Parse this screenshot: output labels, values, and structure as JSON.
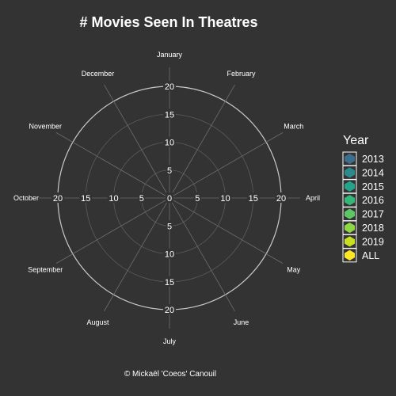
{
  "chart_data": {
    "type": "radar",
    "title": "# Movies Seen In Theatres",
    "categories": [
      "January",
      "February",
      "March",
      "April",
      "May",
      "June",
      "July",
      "August",
      "September",
      "October",
      "November",
      "December"
    ],
    "rlim": [
      0,
      20
    ],
    "r_ticks": [
      "0",
      "5",
      "10",
      "15",
      "20"
    ],
    "grid": true,
    "legend_position": "right",
    "legend_title": "Year",
    "series": [
      {
        "name": "2013",
        "color": "#3E6E8E",
        "values": [
          0,
          0,
          0,
          0,
          0,
          0,
          0,
          0,
          0,
          0,
          0,
          0
        ]
      },
      {
        "name": "2014",
        "color": "#2A8A8C",
        "values": [
          0,
          0,
          0,
          0,
          0,
          0,
          0,
          0,
          0,
          0,
          0,
          0
        ]
      },
      {
        "name": "2015",
        "color": "#22A38A",
        "values": [
          0,
          0,
          0,
          0,
          0,
          0,
          0,
          0,
          0,
          0,
          0,
          0
        ]
      },
      {
        "name": "2016",
        "color": "#35B779",
        "values": [
          0,
          0,
          0,
          0,
          0,
          0,
          0,
          0,
          0,
          0,
          0,
          0
        ]
      },
      {
        "name": "2017",
        "color": "#5CC863",
        "values": [
          0,
          0,
          0,
          0,
          0,
          0,
          0,
          0,
          0,
          0,
          0,
          0
        ]
      },
      {
        "name": "2018",
        "color": "#8FD744",
        "values": [
          0,
          0,
          0,
          0,
          0,
          0,
          0,
          0,
          0,
          0,
          0,
          0
        ]
      },
      {
        "name": "2019",
        "color": "#C7E020",
        "values": [
          0,
          0,
          0,
          0,
          0,
          0,
          0,
          0,
          0,
          0,
          0,
          0
        ]
      },
      {
        "name": "ALL",
        "color": "#FDE725",
        "values": [
          0,
          0,
          0,
          0,
          0,
          0,
          0,
          0,
          0,
          0,
          0,
          0
        ]
      }
    ],
    "caption": "© Mickaël 'Coeos' Canouil"
  }
}
